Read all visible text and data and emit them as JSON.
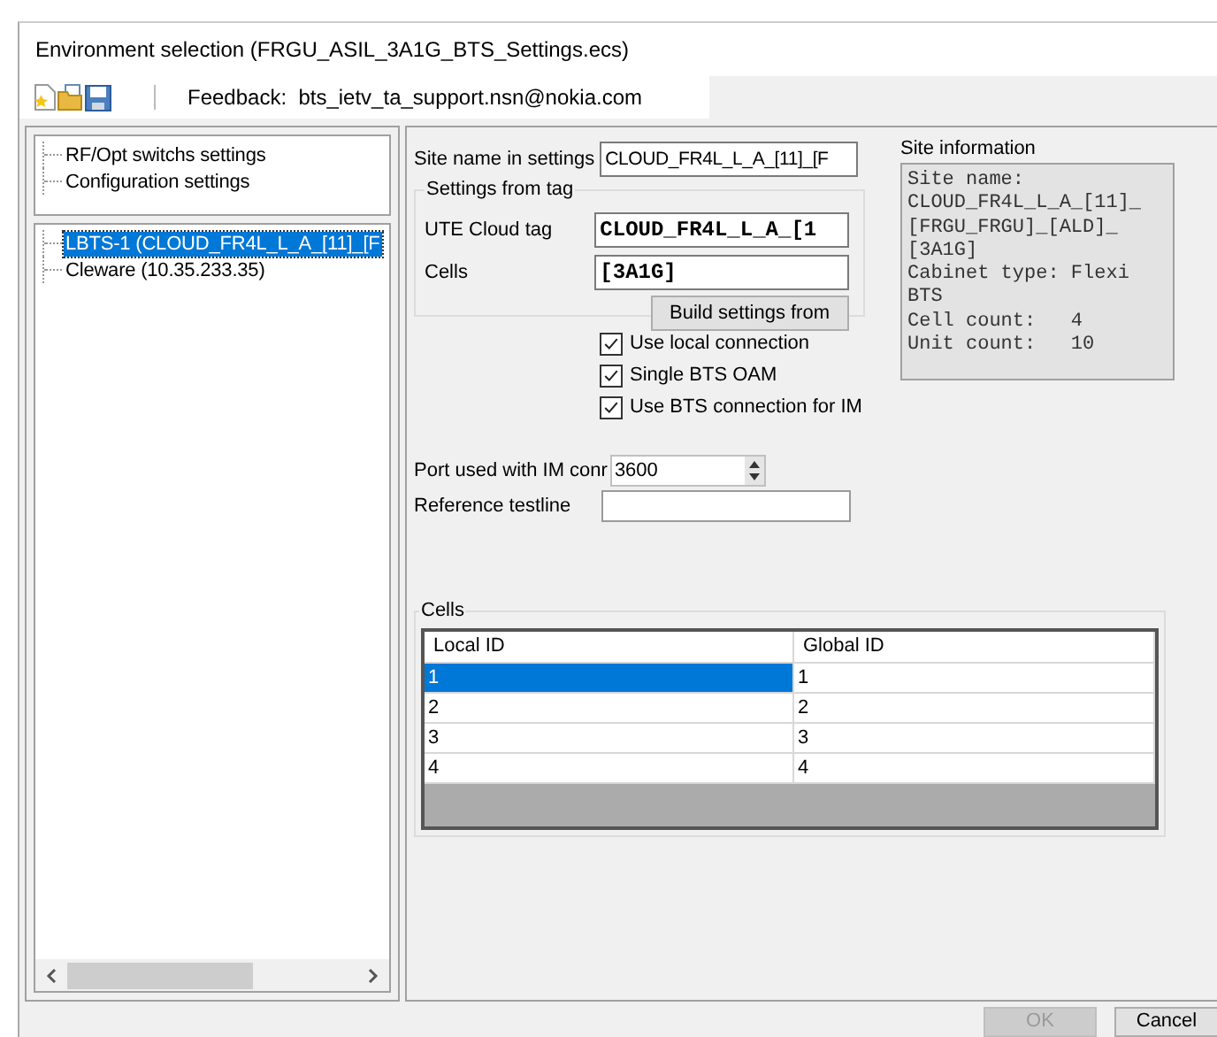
{
  "window": {
    "title": "Environment selection (FRGU_ASIL_3A1G_BTS_Settings.ecs)"
  },
  "toolbar": {
    "feedback_label": "Feedback:",
    "feedback_email": "bts_ietv_ta_support.nsn@nokia.com"
  },
  "settings_tree": [
    {
      "label": "RF/Opt switchs settings",
      "selected": false
    },
    {
      "label": "Configuration settings",
      "selected": false
    }
  ],
  "device_tree": [
    {
      "label": "LBTS-1 (CLOUD_FR4L_L_A_[11]_[F",
      "selected": true
    },
    {
      "label": "Cleware (10.35.233.35)",
      "selected": false
    }
  ],
  "site_name": {
    "label": "Site name in settings",
    "value": "CLOUD_FR4L_L_A_[11]_[F"
  },
  "settings_from_tag": {
    "title": "Settings from tag",
    "ute_cloud_tag": {
      "label": "UTE Cloud tag",
      "value": "CLOUD_FR4L_L_A_[1"
    },
    "cells": {
      "label": "Cells",
      "value": "[3A1G]"
    },
    "button": "Build settings from"
  },
  "options": [
    {
      "label": "Use local connection",
      "checked": true
    },
    {
      "label": "Single BTS OAM",
      "checked": true
    },
    {
      "label": "Use BTS connection for IM",
      "checked": true
    }
  ],
  "port": {
    "label": "Port used with IM conr",
    "value": "3600"
  },
  "reference_testline": {
    "label": "Reference testline"
  },
  "site_information": {
    "title": "Site information",
    "lines": [
      "Site name:",
      "CLOUD_FR4L_L_A_[11]_",
      "[FRGU_FRGU]_[ALD]_",
      "[3A1G]",
      "Cabinet type: Flexi",
      "BTS",
      "Cell count:   4",
      "Unit count:   10"
    ]
  },
  "cells_table": {
    "title": "Cells",
    "columns": [
      "Local ID",
      "Global ID"
    ],
    "rows": [
      {
        "cells": [
          "1",
          "1"
        ],
        "selected": true
      },
      {
        "cells": [
          "2",
          "2"
        ],
        "selected": false
      },
      {
        "cells": [
          "3",
          "3"
        ],
        "selected": false
      },
      {
        "cells": [
          "4",
          "4"
        ],
        "selected": false
      }
    ]
  },
  "buttons": [
    {
      "label": "OK",
      "disabled": true
    },
    {
      "label": "Cancel",
      "disabled": false
    }
  ]
}
